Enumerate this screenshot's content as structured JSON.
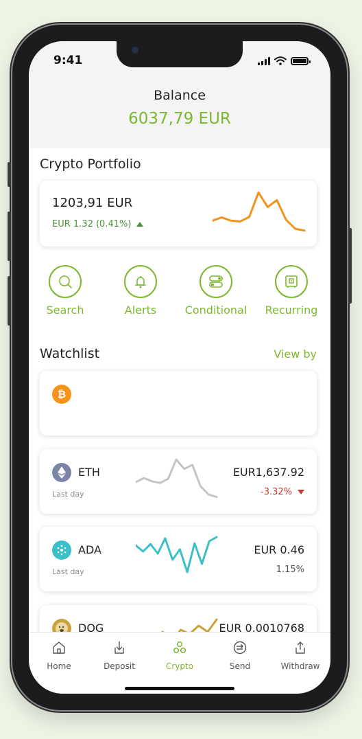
{
  "status": {
    "time": "9:41"
  },
  "balance": {
    "label": "Balance",
    "value": "6037,79 EUR"
  },
  "portfolio": {
    "title": "Crypto Portfolio",
    "value": "1203,91 EUR",
    "change": "EUR 1.32 (0.41%)",
    "direction": "up",
    "sparkline": [
      0.3,
      0.37,
      0.3,
      0.28,
      0.38,
      0.92,
      0.6,
      0.75,
      0.32,
      0.12,
      0.08
    ],
    "sparkline_color": "#f0921e"
  },
  "actions": [
    {
      "label": "Search",
      "icon": "search-icon"
    },
    {
      "label": "Alerts",
      "icon": "bell-icon"
    },
    {
      "label": "Conditional",
      "icon": "toggle-icon"
    },
    {
      "label": "Recurring",
      "icon": "safe-icon"
    }
  ],
  "watchlist": {
    "title": "Watchlist",
    "view_by": "View by",
    "coins": [
      {
        "symbol": "",
        "icon": "bitcoin-icon",
        "icon_color": "#f7931a",
        "price": "",
        "change": "",
        "sub": "",
        "spark": []
      },
      {
        "symbol": "ETH",
        "icon": "ethereum-icon",
        "icon_color": "#7b85a8",
        "price": "EUR1,637.92",
        "change": "-3.32%",
        "direction": "down",
        "sub": "Last day",
        "spark": [
          0.4,
          0.5,
          0.42,
          0.38,
          0.48,
          0.95,
          0.72,
          0.82,
          0.3,
          0.1,
          0.04
        ],
        "spark_color": "#c4c4c4",
        "change_color": "#c9392e"
      },
      {
        "symbol": "ADA",
        "icon": "cardano-icon",
        "icon_color": "#3cbfc8",
        "price": "EUR 0.46",
        "change": "1.15%",
        "direction": "none",
        "sub": "Last day",
        "spark": [
          0.75,
          0.6,
          0.78,
          0.55,
          0.92,
          0.4,
          0.65,
          0.1,
          0.8,
          0.3,
          0.85,
          0.95
        ],
        "spark_color": "#3cbfc8",
        "change_color": "#555555"
      },
      {
        "symbol": "DOG",
        "icon": "dogecoin-icon",
        "icon_color": "#c9a23d",
        "price": "EUR  0.0010768",
        "change": "",
        "sub": "",
        "spark": [
          0.3,
          0.45,
          0.35,
          0.55,
          0.3,
          0.6,
          0.5,
          0.7,
          0.55,
          0.85
        ],
        "spark_color": "#c9a23d"
      }
    ]
  },
  "tabs": [
    {
      "label": "Home",
      "icon": "home-icon"
    },
    {
      "label": "Deposit",
      "icon": "deposit-icon"
    },
    {
      "label": "Crypto",
      "icon": "crypto-icon",
      "active": true
    },
    {
      "label": "Send",
      "icon": "send-icon"
    },
    {
      "label": "Withdraw",
      "icon": "withdraw-icon"
    }
  ]
}
